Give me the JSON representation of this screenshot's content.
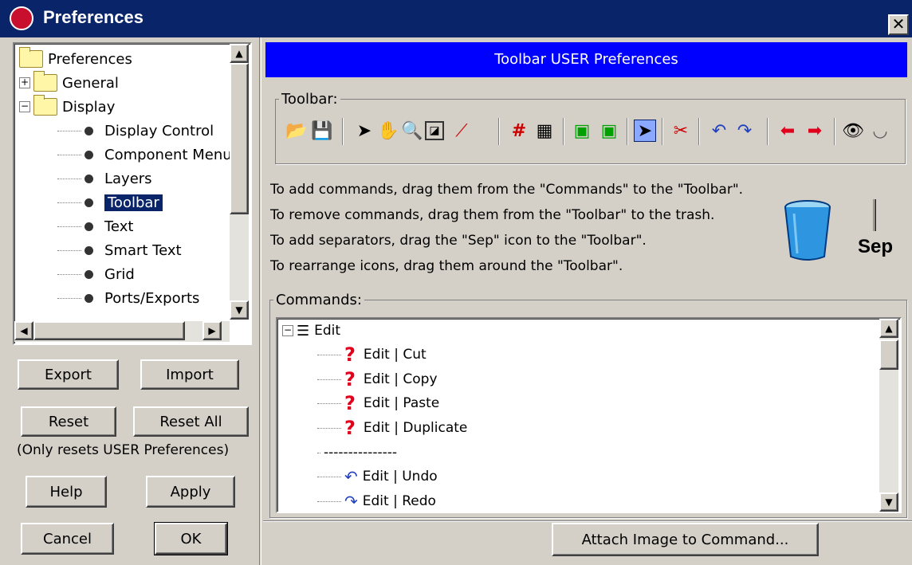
{
  "window": {
    "title": "Preferences",
    "close_glyph": "✕"
  },
  "tree": {
    "root": "Preferences",
    "general": "General",
    "display": "Display",
    "children": [
      "Display Control",
      "Component Menu",
      "Layers",
      "Toolbar",
      "Text",
      "Smart Text",
      "Grid",
      "Ports/Exports"
    ],
    "selected": "Toolbar"
  },
  "buttons": {
    "export": "Export",
    "import": "Import",
    "reset": "Reset",
    "reset_all": "Reset All",
    "reset_note": "(Only resets USER Preferences)",
    "help": "Help",
    "apply": "Apply",
    "cancel": "Cancel",
    "ok": "OK",
    "attach_image": "Attach Image to Command..."
  },
  "header": {
    "title": "Toolbar USER Preferences"
  },
  "toolbar_group": {
    "label": "Toolbar:"
  },
  "instructions": [
    "To add commands, drag them from the \"Commands\" to the \"Toolbar\".",
    "To remove commands, drag them from the \"Toolbar\" to the trash.",
    "To add separators, drag the \"Sep\" icon to the \"Toolbar\".",
    "To rearrange icons, drag them around the \"Toolbar\"."
  ],
  "sep_label": "Sep",
  "commands": {
    "label": "Commands:",
    "group": "Edit",
    "items": [
      "Edit | Cut",
      "Edit | Copy",
      "Edit | Paste",
      "Edit | Duplicate",
      "---------------",
      "Edit | Undo",
      "Edit | Redo"
    ]
  },
  "icons": [
    "open-icon",
    "save-icon",
    "select-arrow-icon",
    "pan-hand-icon",
    "zoom-icon",
    "fit-icon",
    "wire-icon",
    "grid-icon",
    "grid-align-icon",
    "port-icon",
    "export-icon",
    "select-special-icon",
    "tools-icon",
    "undo-icon",
    "redo-icon",
    "back-arrow-icon",
    "forward-arrow-icon",
    "show-icon",
    "hide-icon"
  ],
  "colors": {
    "title_bar": "#0a246a",
    "header_bar": "#0000ff",
    "selection": "#0a246a",
    "error_red": "#e0001b"
  }
}
